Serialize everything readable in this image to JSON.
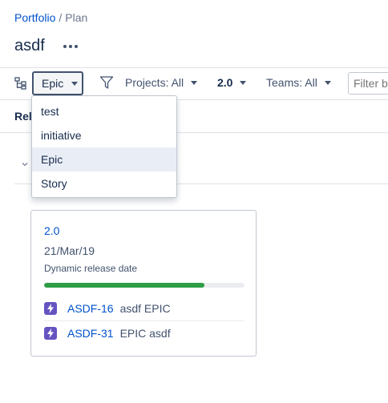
{
  "breadcrumb": {
    "portfolio": "Portfolio",
    "separator": "/",
    "current": "Plan"
  },
  "page": {
    "title": "asdf"
  },
  "toolbar": {
    "hierarchy_label": "Epic",
    "projects_label": "Projects: All",
    "release_label": "2.0",
    "teams_label": "Teams: All",
    "filter_placeholder": "Filter by"
  },
  "section": {
    "label": "Rel"
  },
  "dropdown": {
    "items": [
      {
        "label": "test"
      },
      {
        "label": "initiative"
      },
      {
        "label": "Epic"
      },
      {
        "label": "Story"
      }
    ],
    "selected": "Epic"
  },
  "release": {
    "name": "2.0",
    "date": "21/Mar/19",
    "subtitle": "Dynamic release date",
    "progress": 0.8,
    "issues": [
      {
        "key": "ASDF-16",
        "summary": "asdf EPIC",
        "icon": "epic-lightning-icon"
      },
      {
        "key": "ASDF-31",
        "summary": "EPIC asdf",
        "icon": "epic-lightning-icon"
      }
    ]
  },
  "colors": {
    "link": "#0052cc",
    "text": "#172b4d",
    "muted": "#42526e",
    "progress": "#2e9d45",
    "epic": "#6554c0",
    "selected_bg": "#e9eef6"
  }
}
